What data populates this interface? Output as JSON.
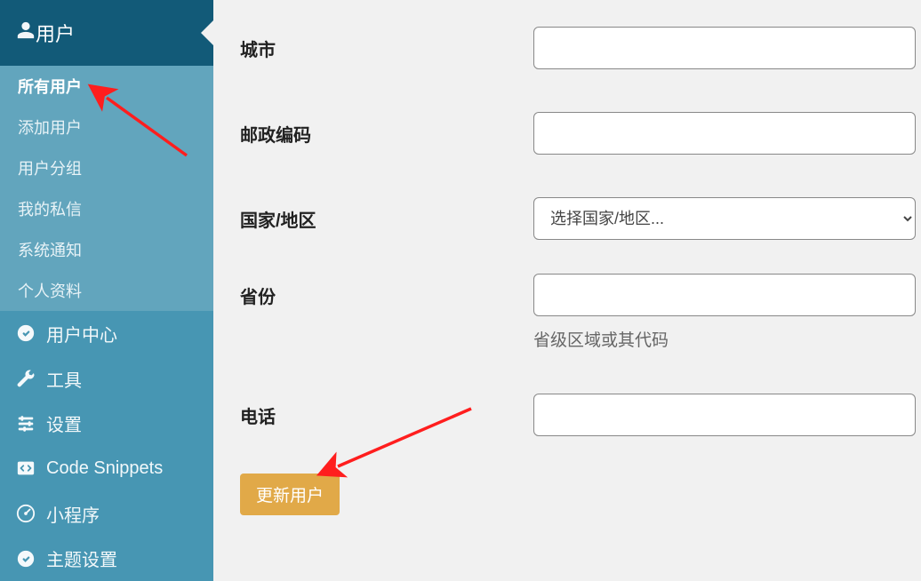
{
  "sidebar": {
    "top": {
      "label": "用户"
    },
    "submenu": [
      {
        "label": "所有用户",
        "active": true
      },
      {
        "label": "添加用户"
      },
      {
        "label": "用户分组"
      },
      {
        "label": "我的私信"
      },
      {
        "label": "系统通知"
      },
      {
        "label": "个人资料"
      }
    ],
    "items": [
      {
        "label": "用户中心",
        "icon": "check-circle-icon"
      },
      {
        "label": "工具",
        "icon": "wrench-icon"
      },
      {
        "label": "设置",
        "icon": "sliders-icon"
      },
      {
        "label": "Code Snippets",
        "icon": "code-icon"
      },
      {
        "label": "小程序",
        "icon": "gauge-icon"
      },
      {
        "label": "主题设置",
        "icon": "check-circle-icon"
      }
    ]
  },
  "form": {
    "city": {
      "label": "城市",
      "value": ""
    },
    "postcode": {
      "label": "邮政编码",
      "value": ""
    },
    "country": {
      "label": "国家/地区",
      "placeholder": "选择国家/地区..."
    },
    "province": {
      "label": "省份",
      "value": "",
      "helper": "省级区域或其代码"
    },
    "phone": {
      "label": "电话",
      "value": ""
    },
    "submit": "更新用户"
  },
  "colors": {
    "sidebar_bg": "#4796b3",
    "sidebar_active_bg": "#125a78",
    "submenu_bg": "#62a5bd",
    "content_bg": "#f1f1f1",
    "accent_btn": "#e1a948",
    "annotation_arrow": "#ff1e1e"
  }
}
